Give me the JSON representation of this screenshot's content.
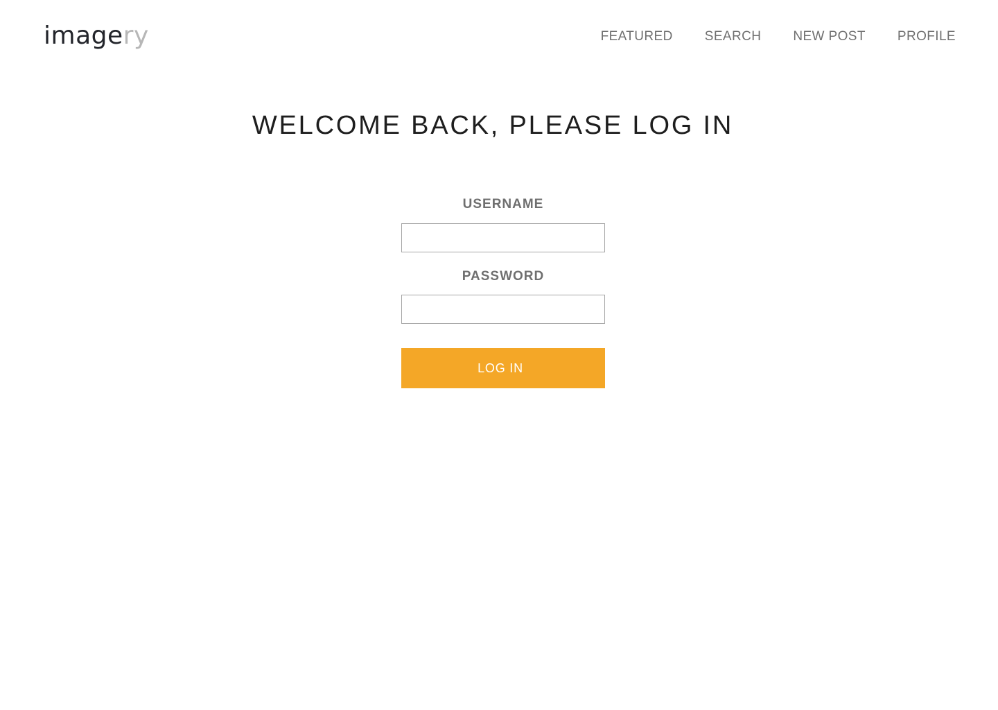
{
  "header": {
    "logo": {
      "dark": "image",
      "light": "ry"
    },
    "nav": [
      {
        "label": "FEATURED"
      },
      {
        "label": "SEARCH"
      },
      {
        "label": "NEW POST"
      },
      {
        "label": "PROFILE"
      }
    ]
  },
  "main": {
    "title": "WELCOME BACK, PLEASE LOG IN",
    "form": {
      "username_label": "USERNAME",
      "username_value": "",
      "password_label": "PASSWORD",
      "password_value": "",
      "submit_label": "LOG IN"
    }
  },
  "colors": {
    "accent": "#f4a727",
    "logo_dark": "#23252b",
    "logo_light": "#b7b7b7",
    "nav_text": "#6f6f6f",
    "title_text": "#1e1e1e"
  }
}
